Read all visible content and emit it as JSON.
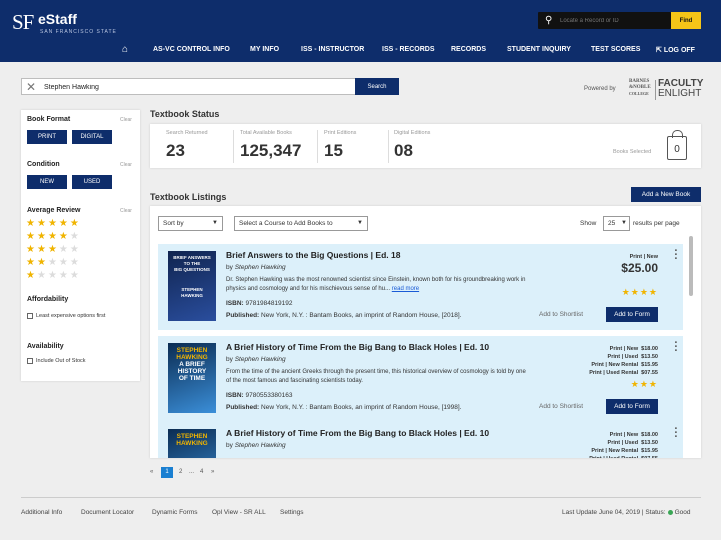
{
  "header": {
    "logo_sf": "SF",
    "app_name": "eStaff",
    "logo_subtitle": "SAN FRANCISCO STATE",
    "search_placeholder": "Locate a Record or ID",
    "find_label": "Find",
    "nav": [
      "AS-VC CONTROL INFO",
      "MY INFO",
      "ISS - INSTRUCTOR",
      "ISS - RECORDS",
      "RECORDS",
      "STUDENT INQUIRY",
      "TEST SCORES",
      "LOG OFF"
    ]
  },
  "search": {
    "value": "Stephen Hawking",
    "button": "Search"
  },
  "powered_by": "Powered by",
  "bn_logo": [
    "BARNES",
    "&NOBLE",
    "COLLEGE"
  ],
  "fe_logo": [
    "FACULTY",
    "ENLIGHT"
  ],
  "sidebar": {
    "clear": "Clear",
    "book_format": {
      "title": "Book Format",
      "options": [
        "PRINT",
        "DIGITAL"
      ]
    },
    "condition": {
      "title": "Condition",
      "options": [
        "NEW",
        "USED"
      ]
    },
    "average_review": {
      "title": "Average Review",
      "rows": [
        5,
        4,
        3,
        2,
        1
      ]
    },
    "affordability": {
      "title": "Affordability",
      "option": "Least expensive options first"
    },
    "availability": {
      "title": "Availability",
      "option": "Include Out of Stock"
    }
  },
  "textbook_status": {
    "title": "Textbook Status",
    "stats": [
      {
        "label": "Search Returned",
        "value": "23"
      },
      {
        "label": "Total Available Books",
        "value": "125,347"
      },
      {
        "label": "Print Editions",
        "value": "15"
      },
      {
        "label": "Digital Editions",
        "value": "08"
      }
    ],
    "books_selected_label": "Books Selected",
    "books_selected_count": "0"
  },
  "listings": {
    "title": "Textbook Listings",
    "add_new": "Add a New Book",
    "sort_by": "Sort by",
    "course_select": "Select a Course to Add Books to",
    "show_label": "Show",
    "per_page": "25",
    "per_page_suffix": "results per page",
    "shortlist_label": "Add to Shortlist",
    "add_form_label": "Add to Form",
    "books": [
      {
        "title": "Brief Answers to the Big Questions | Ed. 18",
        "by": "by",
        "author": "Stephen Hawking",
        "desc": "Dr. Stephen Hawking was the most renowned scientist since Einstein, known both for his groundbreaking work in physics and cosmology and for his mischievous sense of hu...",
        "read_more": "read more",
        "isbn_label": "ISBN:",
        "isbn": "9781984819192",
        "pub_label": "Published:",
        "pub": "New York, N.Y. : Bantam Books, an imprint of Random House, [2018].",
        "prices": [
          {
            "label": "Print | New",
            "price": "$25.00"
          }
        ],
        "stars": 4,
        "cover_text": [
          "BRIEF ANSWERS",
          "TO THE",
          "BIG QUESTIONS",
          "STEPHEN",
          "HAWKING"
        ]
      },
      {
        "title": "A Brief History of Time From the Big Bang to Black Holes | Ed. 10",
        "by": "by",
        "author": "Stephen Hawking",
        "desc": "From the time of the ancient Greeks through the present time, this historical overview of cosmology is told by one of the most famous and fascinating scientists today.",
        "read_more": "",
        "isbn_label": "ISBN:",
        "isbn": "9780553380163",
        "pub_label": "Published:",
        "pub": "New York, N.Y. : Bantam Books, an imprint of Random House, [1998].",
        "prices": [
          {
            "label": "Print | New",
            "price": "$18.00"
          },
          {
            "label": "Print | Used",
            "price": "$13.50"
          },
          {
            "label": "Print | New Rental",
            "price": "$15.95"
          },
          {
            "label": "Print | Used Rental",
            "price": "$07.55"
          }
        ],
        "stars": 3,
        "cover_text": [
          "STEPHEN",
          "HAWKING",
          "A BRIEF",
          "HISTORY",
          "OF TIME"
        ]
      },
      {
        "title": "A Brief History of Time From the Big Bang to Black Holes | Ed. 10",
        "by": "by",
        "author": "Stephen Hawking",
        "desc": "",
        "read_more": "",
        "isbn_label": "",
        "isbn": "",
        "pub_label": "",
        "pub": "",
        "prices": [
          {
            "label": "Print | New",
            "price": "$18.00"
          },
          {
            "label": "Print | Used",
            "price": "$13.50"
          },
          {
            "label": "Print | New Rental",
            "price": "$15.95"
          },
          {
            "label": "Print | Used Rental",
            "price": "$07.55"
          }
        ],
        "stars": 0,
        "cover_text": [
          "STEPHEN",
          "HAWKING"
        ]
      }
    ]
  },
  "pagination": {
    "prev": "«",
    "pages": [
      "1",
      "2",
      "...",
      "4"
    ],
    "next": "»"
  },
  "footer": {
    "links": [
      "Additional Info",
      "Document Locator",
      "Dynamic Forms",
      "Opl View - SR ALL",
      "Settings"
    ],
    "last_update": "Last Update June 04, 2019 | Status:",
    "status": "Good"
  }
}
